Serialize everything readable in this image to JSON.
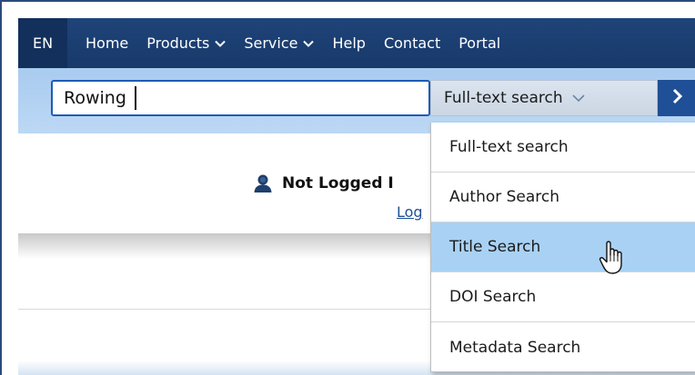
{
  "nav": {
    "language": "EN",
    "items": [
      {
        "label": "Home",
        "has_dropdown": false
      },
      {
        "label": "Products",
        "has_dropdown": true
      },
      {
        "label": "Service",
        "has_dropdown": true
      },
      {
        "label": "Help",
        "has_dropdown": false
      },
      {
        "label": "Contact",
        "has_dropdown": false
      },
      {
        "label": "Portal",
        "has_dropdown": false
      }
    ]
  },
  "search": {
    "query": "Rowing",
    "selected_type": "Full-text search",
    "go_icon": "chevron-right-icon"
  },
  "login": {
    "status": "Not Logged I",
    "link_text": "Log",
    "icon": "user-icon"
  },
  "dropdown": {
    "highlighted_index": 2,
    "options": [
      "Full-text search",
      "Author Search",
      "Title Search",
      "DOI Search",
      "Metadata Search"
    ]
  },
  "colors": {
    "nav_bg": "#1f4479",
    "search_band": "#a9cbef",
    "input_border": "#1f5bb5",
    "highlight": "#a9d1f4",
    "link": "#1f4f96"
  }
}
